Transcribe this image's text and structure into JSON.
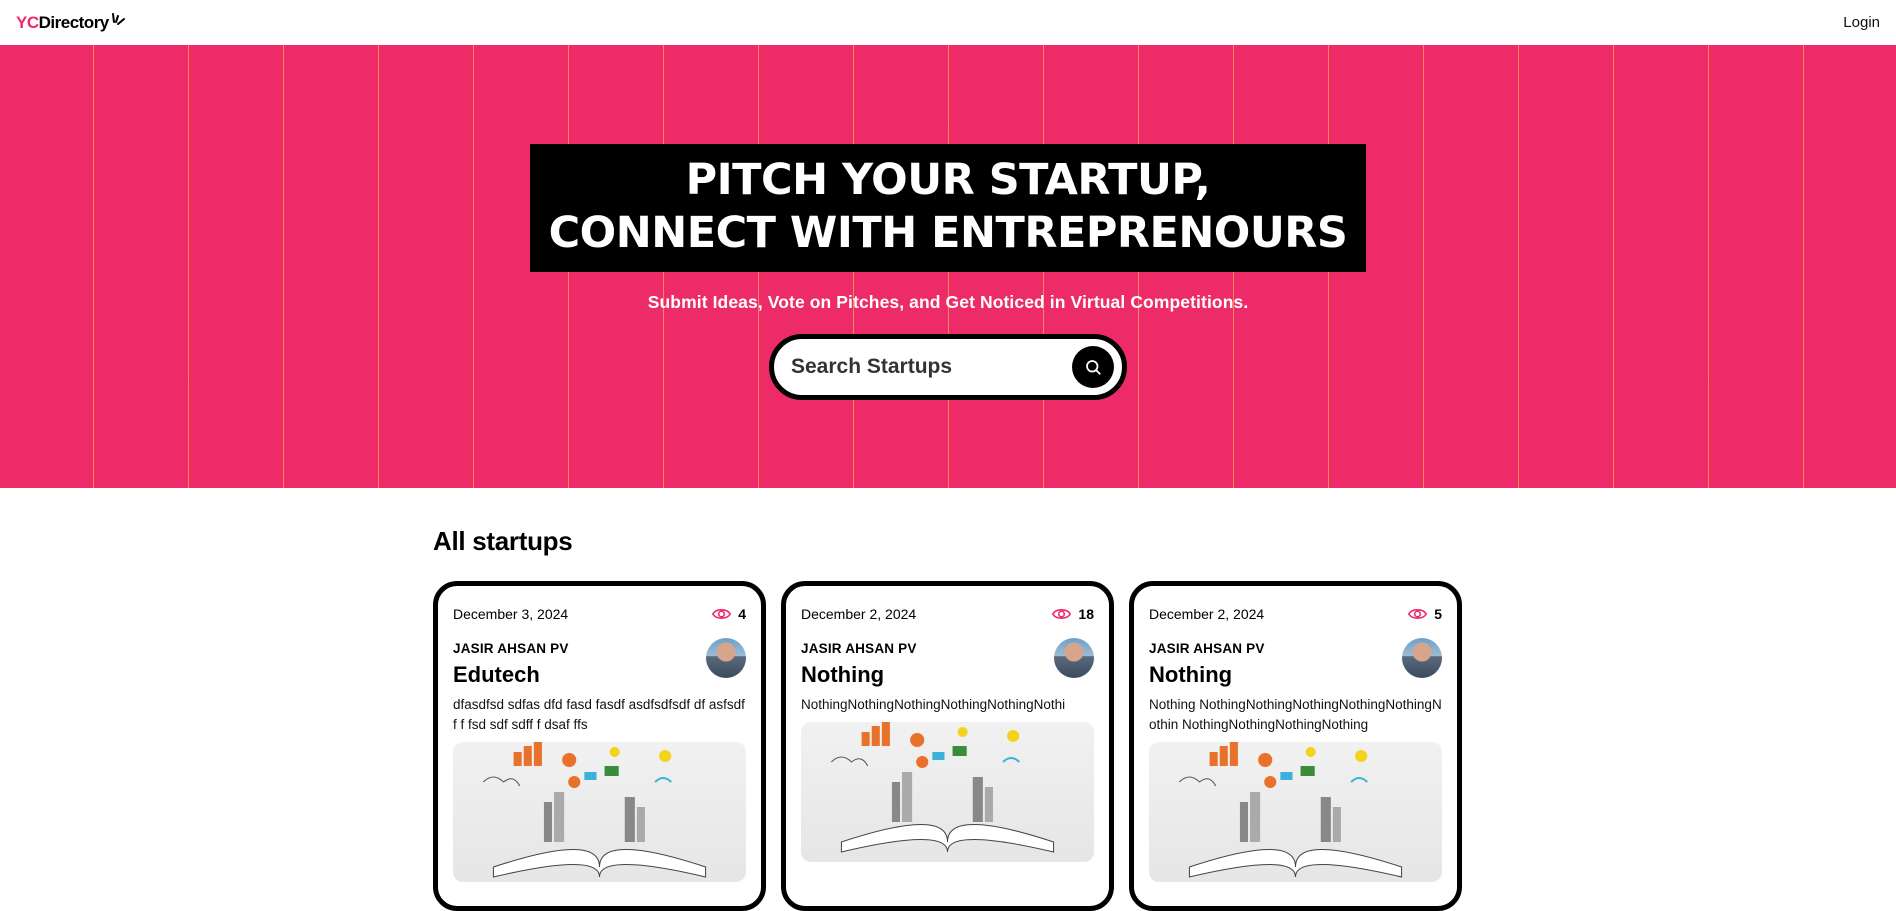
{
  "nav": {
    "logo_yc": "YC",
    "logo_dir": "Directory",
    "login_label": "Login"
  },
  "hero": {
    "headline_line1": "PITCH YOUR STARTUP,",
    "headline_line2": "CONNECT WITH ENTREPRENOURS",
    "subtext": "Submit Ideas, Vote on Pitches, and Get Noticed in Virtual Competitions.",
    "search_placeholder": "Search Startups",
    "background_color": "#ee2b69"
  },
  "section": {
    "title": "All startups"
  },
  "cards": [
    {
      "date": "December 3, 2024",
      "views": "4",
      "author": "JASIR AHSAN PV",
      "title": "Edutech",
      "description": "dfasdfsd sdfas dfd fasd fasdf asdfsdfsdf df asfsdf f f fsd sdf sdff f dsaf ffs"
    },
    {
      "date": "December 2, 2024",
      "views": "18",
      "author": "JASIR AHSAN PV",
      "title": "Nothing",
      "description": "NothingNothingNothingNothingNothingNothi"
    },
    {
      "date": "December 2, 2024",
      "views": "5",
      "author": "JASIR AHSAN PV",
      "title": "Nothing",
      "description": "Nothing NothingNothingNothingNothingNothingNothin NothingNothingNothingNothing"
    }
  ],
  "colors": {
    "accent": "#ee2b69",
    "black": "#000000"
  },
  "icons": [
    "logo-sparkle-icon",
    "search-icon",
    "eye-icon"
  ]
}
